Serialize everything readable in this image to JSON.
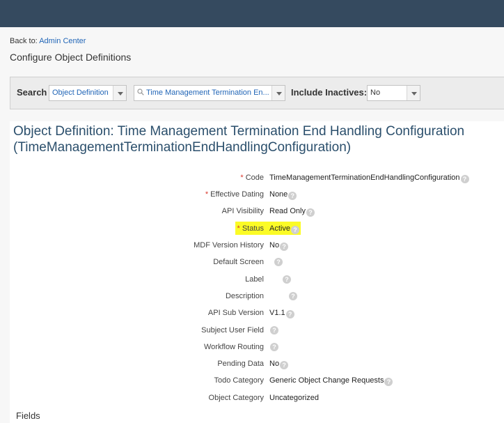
{
  "back": {
    "prefix": "Back to:",
    "link": "Admin Center"
  },
  "page_title": "Configure Object Definitions",
  "search": {
    "label": "Search",
    "type_value": "Object Definition",
    "object_value": "Time Management Termination En...",
    "inactive_label": "Include Inactives:",
    "inactive_value": "No"
  },
  "object": {
    "title_line1": "Object Definition: Time Management Termination End Handling Configuration",
    "title_line2": "(TimeManagementTerminationEndHandlingConfiguration)"
  },
  "properties": [
    {
      "label": "Code",
      "required": true,
      "value": "TimeManagementTerminationEndHandlingConfiguration"
    },
    {
      "label": "Effective Dating",
      "required": true,
      "value": "None"
    },
    {
      "label": "API Visibility",
      "required": false,
      "value": "Read Only"
    },
    {
      "label": "Status",
      "required": true,
      "value": "Active"
    },
    {
      "label": "MDF Version History",
      "required": false,
      "value": "No"
    },
    {
      "label": "Default Screen",
      "required": false,
      "value": ""
    },
    {
      "label": "Label",
      "required": false,
      "value": ""
    },
    {
      "label": "Description",
      "required": false,
      "value": ""
    },
    {
      "label": "API Sub Version",
      "required": false,
      "value": "V1.1"
    },
    {
      "label": "Subject User Field",
      "required": false,
      "value": ""
    },
    {
      "label": "Workflow Routing",
      "required": false,
      "value": ""
    },
    {
      "label": "Pending Data",
      "required": false,
      "value": "No"
    },
    {
      "label": "Todo Category",
      "required": false,
      "value": "Generic Object Change Requests"
    },
    {
      "label": "Object Category",
      "required": false,
      "value": "Uncategorized"
    }
  ],
  "required_marker": "*",
  "help_glyph": "?",
  "fields_heading": "Fields",
  "colors": {
    "topbar": "#354a5f",
    "link": "#2266b7",
    "title": "#2b4f6c",
    "highlight": "#fafa00"
  }
}
